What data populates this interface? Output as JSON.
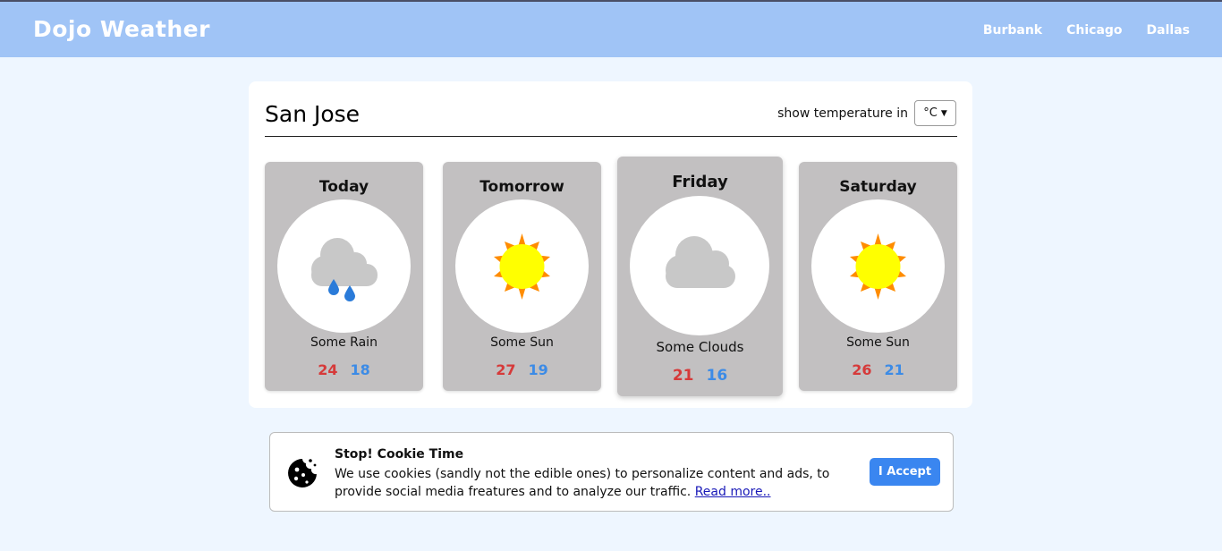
{
  "header": {
    "brand": "Dojo Weather",
    "nav": [
      "Burbank",
      "Chicago",
      "Dallas"
    ]
  },
  "main": {
    "city": "San Jose",
    "unit_label": "show temperature in",
    "unit_selected": "°C",
    "forecast": [
      {
        "day": "Today",
        "icon": "rain-cloud-icon",
        "desc": "Some Rain",
        "high": "24",
        "low": "18"
      },
      {
        "day": "Tomorrow",
        "icon": "sun-icon",
        "desc": "Some Sun",
        "high": "27",
        "low": "19"
      },
      {
        "day": "Friday",
        "icon": "cloud-icon",
        "desc": "Some Clouds",
        "high": "21",
        "low": "16"
      },
      {
        "day": "Saturday",
        "icon": "sun-icon",
        "desc": "Some Sun",
        "high": "26",
        "low": "21"
      }
    ]
  },
  "cookie": {
    "icon": "cookie-icon",
    "title": "Stop! Cookie Time",
    "text": "We use cookies (sandly not the edible ones) to personalize content and ads, to provide social media freatures and to analyze our traffic.",
    "link": "Read more..",
    "accept_label": "I Accept"
  },
  "colors": {
    "header_bg": "#a0c4f6",
    "page_bg": "#eef6ff",
    "card_bg": "#c2c0c1",
    "high_temp": "#d63a3a",
    "low_temp": "#3c8be6",
    "accept_button": "#3a86f0"
  }
}
